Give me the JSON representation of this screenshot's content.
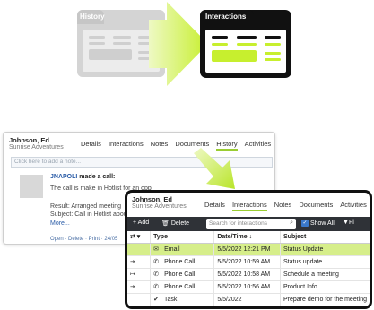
{
  "illustration": {
    "left_tab": "History",
    "right_tab": "Interactions",
    "colors": {
      "green": "#c7ef2e",
      "dark": "#111111",
      "gray": "#d4d4d4"
    }
  },
  "history_panel": {
    "contact_name": "Johnson, Ed",
    "company": "Sunrise Adventures",
    "tabs": [
      "Details",
      "Interactions",
      "Notes",
      "Documents",
      "History",
      "Activities"
    ],
    "active_tab": "History",
    "note_placeholder": "Click here to add a note...",
    "entry": {
      "user": "JNAPOLI",
      "action": "made a call:",
      "line1": "The call is make in Hotlist for an opp",
      "line2": "Result: Arranged meeting",
      "line3": "Subject: Call in Hotlist about",
      "more": "More..."
    },
    "footer": "Open · Delete · Print · 24/05"
  },
  "interactions_panel": {
    "contact_name": "Johnson, Ed",
    "company": "Sunrise Adventures",
    "tabs": [
      "Details",
      "Interactions",
      "Notes",
      "Documents",
      "Activities"
    ],
    "active_tab": "Interactions",
    "toolbar": {
      "add": "+ Add",
      "delete": "Delete",
      "search_placeholder": "Search for interactions",
      "show_all": "Show All",
      "filter": "Fi"
    },
    "columns": [
      "Type",
      "Date/Time ↓",
      "Subject"
    ],
    "rows": [
      {
        "type": "Email",
        "date": "5/5/2022 12:21 PM",
        "subject": "Status Update",
        "selected": true
      },
      {
        "type": "Phone Call",
        "date": "5/5/2022 10:59 AM",
        "subject": "Status update",
        "selected": false
      },
      {
        "type": "Phone Call",
        "date": "5/5/2022 10:58 AM",
        "subject": "Schedule a meeting",
        "selected": false
      },
      {
        "type": "Phone Call",
        "date": "5/5/2022 10:56 AM",
        "subject": "Product Info",
        "selected": false
      },
      {
        "type": "Task",
        "date": "5/5/2022",
        "subject": "Prepare demo for the meeting",
        "selected": false
      }
    ]
  }
}
